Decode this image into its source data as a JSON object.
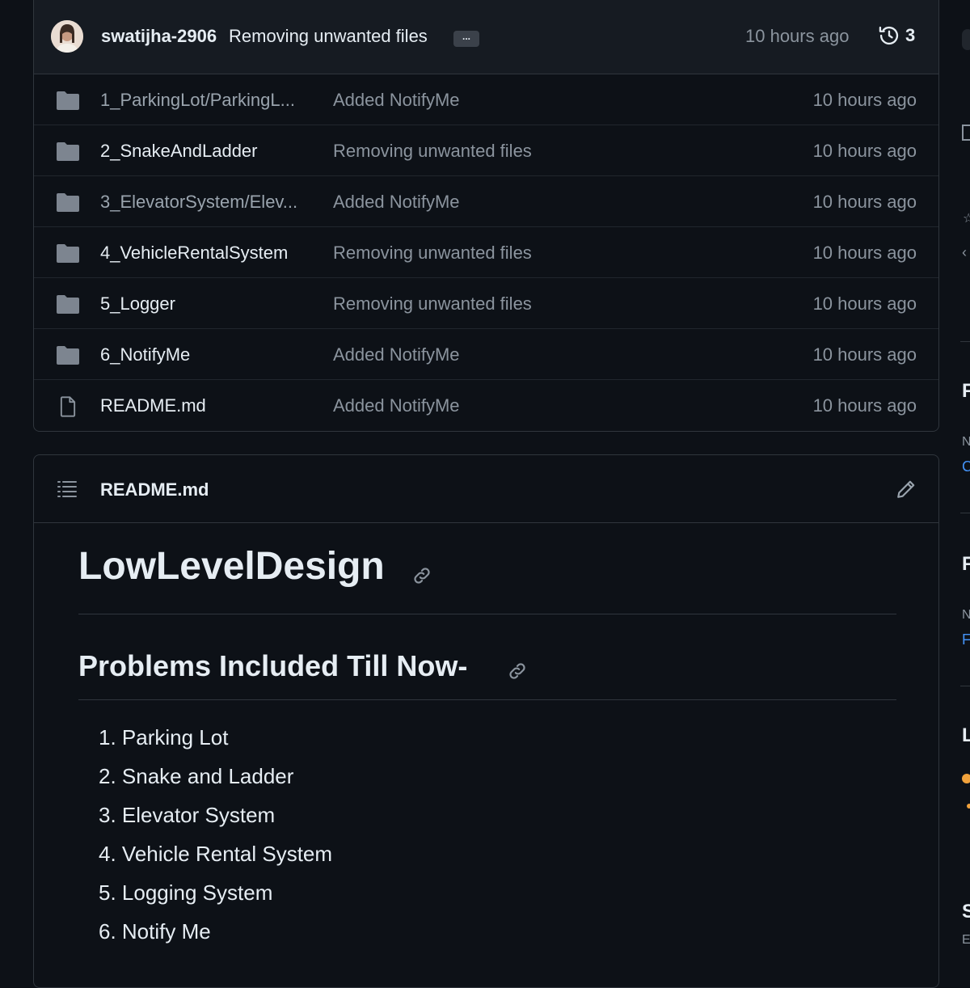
{
  "commit": {
    "author": "swatijha-2906",
    "message": "Removing unwanted files",
    "ellipsis": "...",
    "time": "10 hours ago",
    "history_count": "3"
  },
  "files": [
    {
      "type": "folder",
      "name": "1_ParkingLot/ParkingL...",
      "message": "Added NotifyMe",
      "time": "10 hours ago"
    },
    {
      "type": "folder",
      "name": "2_SnakeAndLadder",
      "message": "Removing unwanted files",
      "time": "10 hours ago"
    },
    {
      "type": "folder",
      "name": "3_ElevatorSystem/Elev...",
      "message": "Added NotifyMe",
      "time": "10 hours ago"
    },
    {
      "type": "folder",
      "name": "4_VehicleRentalSystem",
      "message": "Removing unwanted files",
      "time": "10 hours ago"
    },
    {
      "type": "folder",
      "name": "5_Logger",
      "message": "Removing unwanted files",
      "time": "10 hours ago"
    },
    {
      "type": "folder",
      "name": "6_NotifyMe",
      "message": "Added NotifyMe",
      "time": "10 hours ago"
    },
    {
      "type": "file",
      "name": "README.md",
      "message": "Added NotifyMe",
      "time": "10 hours ago"
    }
  ],
  "readme": {
    "file_label": "README.md",
    "h1": "LowLevelDesign",
    "h2": "Problems Included Till Now-",
    "problems": [
      "1. Parking Lot",
      "2. Snake and Ladder",
      "3. Elevator System",
      "4. Vehicle Rental System",
      "5. Logging System",
      "6. Notify Me"
    ]
  },
  "sidebar_fragments": {
    "heading_1": "F",
    "small_1": "N",
    "link_1": "C",
    "heading_2": "F",
    "small_2": "N",
    "link_2": "F",
    "heading_3": "L",
    "heading_4": "S",
    "small_4": "E"
  },
  "colors": {
    "background": "#0d1117",
    "header_bg": "#161b22",
    "border": "#30363d",
    "text": "#e6edf3",
    "muted": "#8b949e",
    "folder": "#7d8590",
    "link": "#4493f8",
    "language_dot": "#f1a23c"
  }
}
